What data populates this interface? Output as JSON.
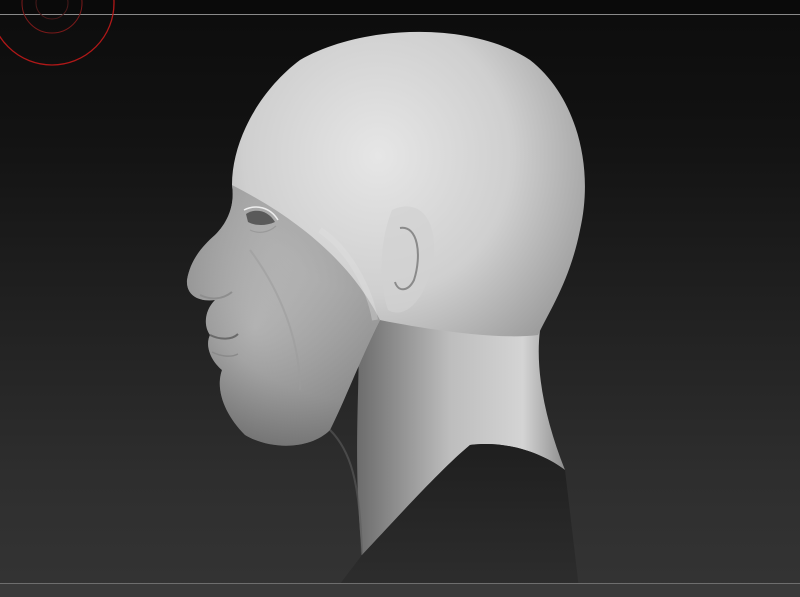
{
  "app": {
    "view": "3d-sculpt-viewport"
  },
  "viewport": {
    "background_top": "#0c0c0c",
    "background_bottom": "#343434",
    "model_color": "#c9c9c9"
  },
  "gizmo": {
    "icon": "navigation-ring-icon",
    "color": "#b01818"
  },
  "model": {
    "icon": "sculpted-head-icon"
  }
}
